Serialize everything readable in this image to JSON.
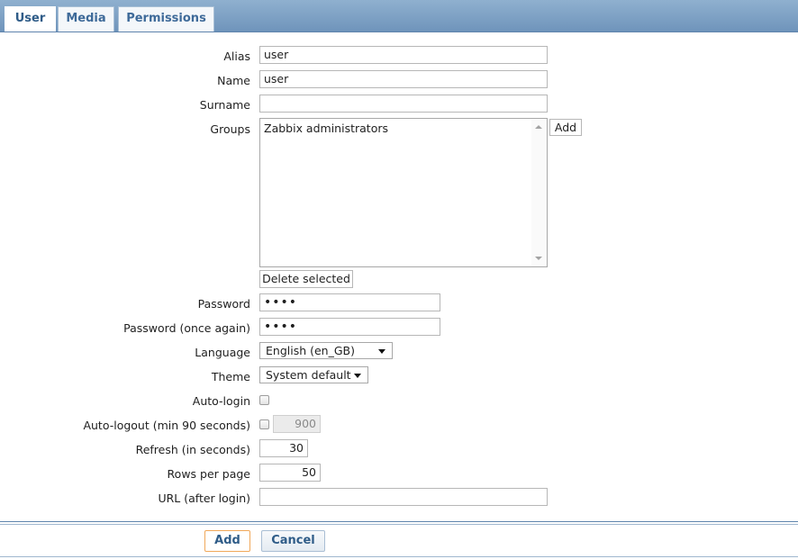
{
  "tabs": [
    {
      "label": "User"
    },
    {
      "label": "Media"
    },
    {
      "label": "Permissions"
    }
  ],
  "form": {
    "alias": {
      "label": "Alias",
      "value": "user"
    },
    "name": {
      "label": "Name",
      "value": "user"
    },
    "surname": {
      "label": "Surname",
      "value": ""
    },
    "groups": {
      "label": "Groups",
      "items": [
        "Zabbix administrators"
      ],
      "add_label": "Add",
      "delete_label": "Delete selected"
    },
    "password": {
      "label": "Password",
      "value": "••••"
    },
    "password_again": {
      "label": "Password (once again)",
      "value": "••••"
    },
    "language": {
      "label": "Language",
      "value": "English (en_GB)"
    },
    "theme": {
      "label": "Theme",
      "value": "System default"
    },
    "autologin": {
      "label": "Auto-login",
      "checked": false
    },
    "autologout": {
      "label": "Auto-logout (min 90 seconds)",
      "checked": false,
      "value": "900"
    },
    "refresh": {
      "label": "Refresh (in seconds)",
      "value": "30"
    },
    "rows_per_page": {
      "label": "Rows per page",
      "value": "50"
    },
    "url": {
      "label": "URL (after login)",
      "value": ""
    }
  },
  "footer": {
    "add_label": "Add",
    "cancel_label": "Cancel"
  },
  "colors": {
    "tabbar": "#7ea2c6",
    "accent_text": "#2f5c88",
    "add_border": "#f0a85a"
  }
}
